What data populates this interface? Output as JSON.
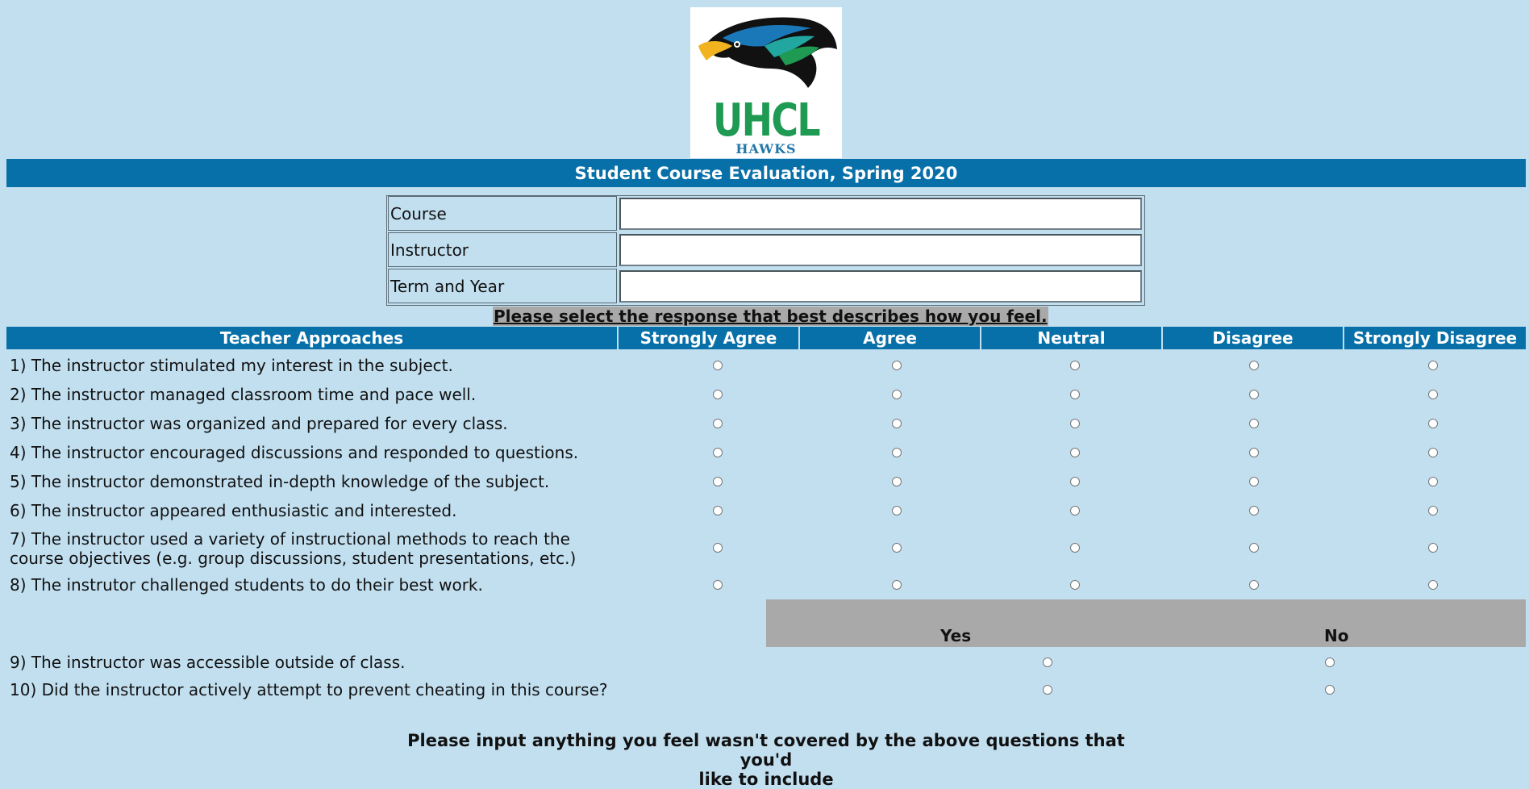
{
  "logo": {
    "wordmark": "UHCL",
    "sub": "HAWKS"
  },
  "title": "Student Course Evaluation, Spring 2020",
  "info": [
    {
      "label": "Course",
      "value": ""
    },
    {
      "label": "Instructor",
      "value": ""
    },
    {
      "label": "Term and Year",
      "value": ""
    }
  ],
  "instruction": "Please select the response that best describes how you feel.",
  "scale_header": {
    "category": "Teacher Approaches",
    "options": [
      "Strongly Agree",
      "Agree",
      "Neutral",
      "Disagree",
      "Strongly Disagree"
    ]
  },
  "questions": [
    "1) The instructor stimulated my interest in the subject.",
    "2) The instructor managed classroom time and pace well.",
    "3) The instructor was organized and prepared for every class.",
    "4) The instructor encouraged discussions and responded to questions.",
    "5) The instructor demonstrated in-depth knowledge of the subject.",
    "6) The instructor appeared enthusiastic and interested.",
    "7) The instructor used a variety of instructional methods to reach the",
    "course objectives (e.g. group discussions, student presentations, etc.)",
    "8) The instrutor challenged students to do their best work."
  ],
  "yes_no": {
    "labels": [
      "Yes",
      "No"
    ],
    "questions": [
      "9) The instructor was accessible outside of class.",
      "10) Did the instructor actively attempt to prevent cheating in this course?"
    ]
  },
  "footer": {
    "line1": "Please input anything you feel wasn't covered by the above questions that you'd",
    "line2": "like to include"
  },
  "colors": {
    "background": "#c2dff0",
    "header_blue": "#0870a9",
    "gray_band": "#a9a9a9"
  }
}
